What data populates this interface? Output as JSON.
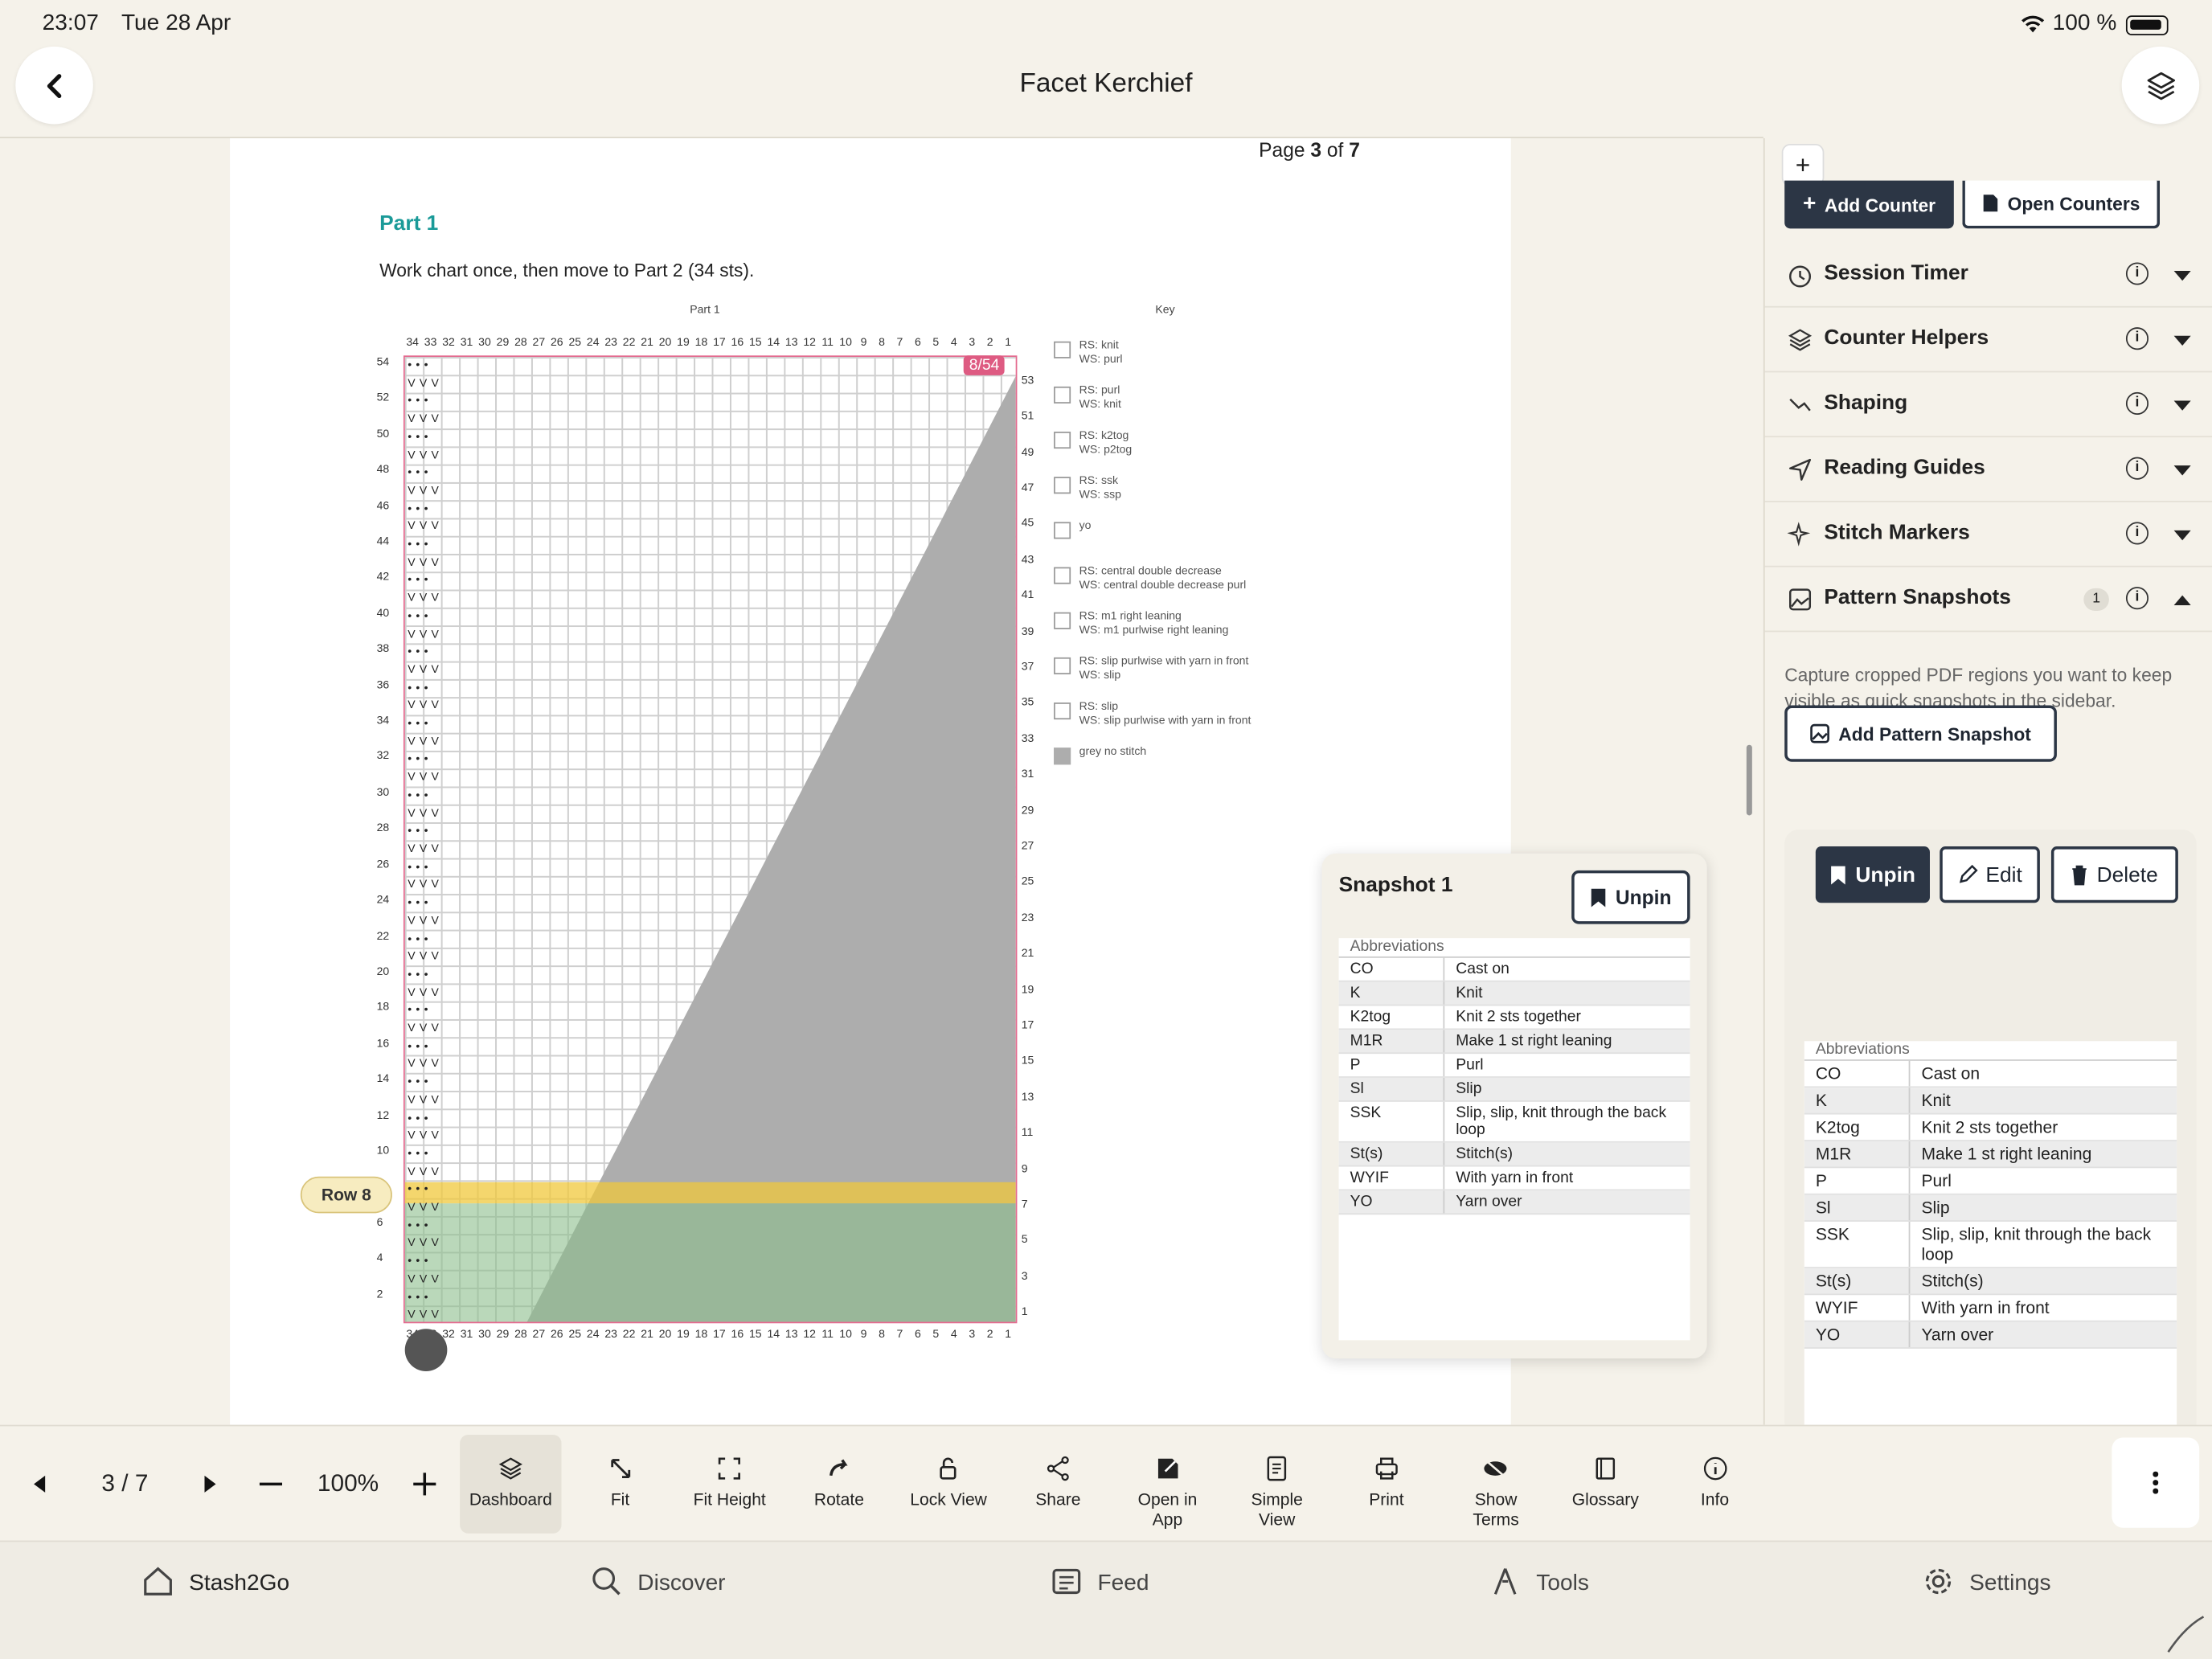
{
  "status": {
    "time": "23:07",
    "date": "Tue 28 Apr",
    "battery": "100 %"
  },
  "header": {
    "title": "Facet Kerchief"
  },
  "page": {
    "page_label_prefix": "Page ",
    "page_current": "3",
    "page_label_mid": " of ",
    "page_total": "7",
    "section_title": "Part 1",
    "instruction": "Work chart once, then move to Part 2 (34 sts).",
    "chart_title": "Part 1",
    "key_title": "Key",
    "row_counter_badge": "8/54",
    "row_pill": "Row 8",
    "column_numbers": [
      "34",
      "33",
      "32",
      "31",
      "30",
      "29",
      "28",
      "27",
      "26",
      "25",
      "24",
      "23",
      "22",
      "21",
      "20",
      "19",
      "18",
      "17",
      "16",
      "15",
      "14",
      "13",
      "12",
      "11",
      "10",
      "9",
      "8",
      "7",
      "6",
      "5",
      "4",
      "3",
      "2",
      "1"
    ],
    "left_rows": [
      "54",
      "52",
      "50",
      "48",
      "46",
      "44",
      "42",
      "40",
      "38",
      "36",
      "34",
      "32",
      "30",
      "28",
      "26",
      "24",
      "22",
      "20",
      "18",
      "16",
      "14",
      "12",
      "10",
      "8",
      "6",
      "4",
      "2"
    ],
    "right_rows": [
      "53",
      "51",
      "49",
      "47",
      "45",
      "43",
      "41",
      "39",
      "37",
      "35",
      "33",
      "31",
      "29",
      "27",
      "25",
      "23",
      "21",
      "19",
      "17",
      "15",
      "13",
      "11",
      "9",
      "7",
      "5",
      "3",
      "1"
    ],
    "key": [
      {
        "rs": "RS: knit",
        "ws": "WS: purl"
      },
      {
        "rs": "RS: purl",
        "ws": "WS: knit"
      },
      {
        "rs": "RS: k2tog",
        "ws": "WS: p2tog"
      },
      {
        "rs": "RS: ssk",
        "ws": "WS: ssp"
      },
      {
        "rs": "yo",
        "ws": ""
      },
      {
        "rs": "RS: central double decrease",
        "ws": "WS: central double decrease purl"
      },
      {
        "rs": "RS: m1 right leaning",
        "ws": "WS: m1 purlwise right leaning"
      },
      {
        "rs": "RS: slip purlwise with yarn in front",
        "ws": "WS: slip"
      },
      {
        "rs": "RS: slip",
        "ws": "WS: slip purlwise with yarn in front"
      },
      {
        "rs": "grey no stitch",
        "ws": ""
      }
    ]
  },
  "snapshot_window": {
    "title": "Snapshot 1",
    "unpin_label": "Unpin",
    "abbr_header": "Abbreviations",
    "rows": [
      {
        "abbr": "CO",
        "meaning": "Cast on"
      },
      {
        "abbr": "K",
        "meaning": "Knit"
      },
      {
        "abbr": "K2tog",
        "meaning": "Knit 2 sts together"
      },
      {
        "abbr": "M1R",
        "meaning": "Make 1 st right leaning"
      },
      {
        "abbr": "P",
        "meaning": "Purl"
      },
      {
        "abbr": "Sl",
        "meaning": "Slip"
      },
      {
        "abbr": "SSK",
        "meaning": "Slip, slip, knit through the back loop"
      },
      {
        "abbr": "St(s)",
        "meaning": "Stitch(s)"
      },
      {
        "abbr": "WYIF",
        "meaning": "With yarn in front"
      },
      {
        "abbr": "YO",
        "meaning": "Yarn over"
      }
    ]
  },
  "sidebar": {
    "add_counter": "Add Counter",
    "open_counters": "Open Counters",
    "sections": [
      {
        "label": "Session Timer",
        "icon": "timer-icon"
      },
      {
        "label": "Counter Helpers",
        "icon": "layers-icon"
      },
      {
        "label": "Shaping",
        "icon": "shaping-icon"
      },
      {
        "label": "Reading Guides",
        "icon": "navigation-icon"
      },
      {
        "label": "Stitch Markers",
        "icon": "sparkle-icon"
      },
      {
        "label": "Pattern Snapshots",
        "icon": "image-icon",
        "badge": "1"
      }
    ],
    "snapshots_description": "Capture cropped PDF regions you want to keep visible as quick snapshots in the sidebar.",
    "add_snapshot": "Add Pattern Snapshot",
    "card": {
      "unpin": "Unpin",
      "edit": "Edit",
      "delete": "Delete",
      "abbr_header": "Abbreviations",
      "rows": [
        {
          "abbr": "CO",
          "meaning": "Cast on"
        },
        {
          "abbr": "K",
          "meaning": "Knit"
        },
        {
          "abbr": "K2tog",
          "meaning": "Knit 2 sts together"
        },
        {
          "abbr": "M1R",
          "meaning": "Make 1 st right leaning"
        },
        {
          "abbr": "P",
          "meaning": "Purl"
        },
        {
          "abbr": "Sl",
          "meaning": "Slip"
        },
        {
          "abbr": "SSK",
          "meaning": "Slip, slip, knit through the back loop"
        },
        {
          "abbr": "St(s)",
          "meaning": "Stitch(s)"
        },
        {
          "abbr": "WYIF",
          "meaning": "With yarn in front"
        },
        {
          "abbr": "YO",
          "meaning": "Yarn over"
        }
      ]
    }
  },
  "toolbar": {
    "page_indicator": "3 / 7",
    "zoom": "100%",
    "buttons": [
      {
        "label": "Dashboard",
        "icon": "layers-icon",
        "active": true
      },
      {
        "label": "Fit",
        "icon": "fit-arrows-icon"
      },
      {
        "label": "Fit Height",
        "icon": "fit-height-icon"
      },
      {
        "label": "Rotate",
        "icon": "rotate-icon"
      },
      {
        "label": "Lock View",
        "icon": "lock-icon"
      },
      {
        "label": "Share",
        "icon": "share-icon"
      },
      {
        "label": "Open in App",
        "icon": "open-in-app-icon"
      },
      {
        "label": "Simple View",
        "icon": "document-icon"
      },
      {
        "label": "Print",
        "icon": "printer-icon"
      },
      {
        "label": "Show Terms",
        "icon": "eye-hidden-icon"
      },
      {
        "label": "Glossary",
        "icon": "book-icon"
      },
      {
        "label": "Info",
        "icon": "info-icon"
      }
    ]
  },
  "tabs": [
    {
      "label": "Stash2Go",
      "icon": "home-icon"
    },
    {
      "label": "Discover",
      "icon": "discover-icon"
    },
    {
      "label": "Feed",
      "icon": "feed-icon"
    },
    {
      "label": "Tools",
      "icon": "tools-icon"
    },
    {
      "label": "Settings",
      "icon": "gear-icon"
    }
  ]
}
